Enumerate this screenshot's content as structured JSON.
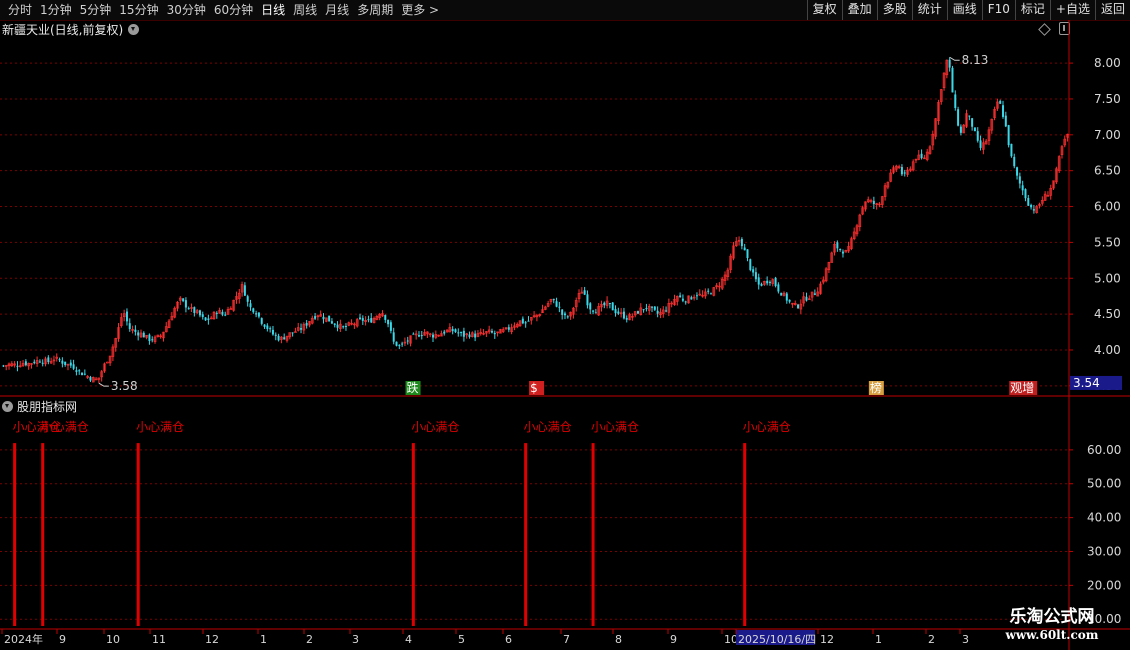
{
  "toolbar": {
    "periods": [
      "分时",
      "1分钟",
      "5分钟",
      "15分钟",
      "30分钟",
      "60分钟",
      "日线",
      "周线",
      "月线",
      "多周期",
      "更多 >"
    ],
    "active_period": "日线",
    "buttons": [
      "复权",
      "叠加",
      "多股",
      "统计",
      "画线",
      "F10",
      "标记",
      "+自选",
      "返回"
    ]
  },
  "chart_title": "新疆天业(日线,前复权)",
  "indicator_title": "股朋指标网",
  "price_axis": {
    "ticks": [
      "8.00",
      "7.50",
      "7.00",
      "6.50",
      "6.00",
      "5.50",
      "5.00",
      "4.50",
      "4.00",
      "3.50"
    ],
    "current_price": "3.54"
  },
  "indicator_axis": {
    "ticks": [
      "60.00",
      "50.00",
      "40.00",
      "30.00",
      "20.00",
      "10.00"
    ]
  },
  "annotations": {
    "high": "8.13",
    "low": "3.58"
  },
  "event_markers": [
    {
      "text": "跌",
      "color": "#1e8a1e"
    },
    {
      "text": "$",
      "color": "#d02020"
    },
    {
      "text": "榜",
      "color": "#d8a040"
    },
    {
      "text": "观增",
      "color": "#c02020"
    }
  ],
  "signals": [
    {
      "text": "小心满仓"
    },
    {
      "text": "小心满仓"
    },
    {
      "text": "小心满仓"
    },
    {
      "text": "小心满仓"
    },
    {
      "text": "小心满仓"
    },
    {
      "text": "小心满仓"
    },
    {
      "text": "小心满仓"
    }
  ],
  "time_axis": [
    "2024年",
    "9",
    "10",
    "11",
    "12",
    "1",
    "2",
    "3",
    "4",
    "5",
    "6",
    "7",
    "8",
    "9",
    "10",
    "2025/10/16/四",
    "12",
    "1",
    "2",
    "3"
  ],
  "watermark": {
    "title": "乐淘公式网",
    "url": "www.60lt.com"
  },
  "colors": {
    "up": "#ff3030",
    "down": "#3ad8e8",
    "grid": "#7a0000",
    "axis": "#c00000",
    "signal": "#e00000"
  },
  "chart_data": {
    "type": "candlestick",
    "y_range": [
      3.4,
      8.35
    ],
    "indicator_range": [
      8,
      70
    ],
    "signal_value": 62,
    "close_path": [
      3.78,
      3.8,
      3.79,
      3.82,
      3.81,
      3.84,
      3.86,
      3.83,
      3.88,
      3.85,
      3.8,
      3.78,
      3.7,
      3.65,
      3.6,
      3.58,
      3.78,
      3.95,
      4.2,
      4.55,
      4.3,
      4.25,
      4.22,
      4.15,
      4.15,
      4.2,
      4.35,
      4.55,
      4.7,
      4.62,
      4.55,
      4.5,
      4.4,
      4.45,
      4.55,
      4.48,
      4.6,
      4.75,
      4.9,
      4.6,
      4.55,
      4.4,
      4.3,
      4.2,
      4.15,
      4.2,
      4.25,
      4.28,
      4.35,
      4.45,
      4.5,
      4.45,
      4.4,
      4.35,
      4.3,
      4.35,
      4.38,
      4.42,
      4.4,
      4.45,
      4.55,
      4.4,
      4.1,
      4.05,
      4.12,
      4.18,
      4.22,
      4.25,
      4.2,
      4.22,
      4.25,
      4.28,
      4.25,
      4.2,
      4.22,
      4.2,
      4.22,
      4.25,
      4.22,
      4.25,
      4.28,
      4.35,
      4.4,
      4.38,
      4.45,
      4.5,
      4.6,
      4.7,
      4.62,
      4.45,
      4.48,
      4.7,
      4.85,
      4.6,
      4.55,
      4.6,
      4.65,
      4.55,
      4.5,
      4.45,
      4.48,
      4.55,
      4.6,
      4.55,
      4.5,
      4.55,
      4.65,
      4.75,
      4.7,
      4.72,
      4.78,
      4.75,
      4.8,
      4.85,
      4.95,
      5.1,
      5.45,
      5.55,
      5.3,
      5.05,
      4.9,
      4.95,
      5.0,
      4.85,
      4.75,
      4.65,
      4.6,
      4.7,
      4.75,
      4.8,
      4.95,
      5.2,
      5.45,
      5.4,
      5.35,
      5.6,
      5.9,
      6.1,
      6.05,
      6.0,
      6.3,
      6.45,
      6.6,
      6.4,
      6.55,
      6.7,
      6.65,
      6.8,
      7.2,
      7.7,
      8.1,
      7.4,
      7.0,
      7.3,
      7.1,
      6.8,
      6.9,
      7.2,
      7.5,
      7.2,
      6.7,
      6.4,
      6.2,
      6.0,
      5.95,
      6.1,
      6.2,
      6.4,
      6.8,
      7.0
    ],
    "signal_bars": [
      4,
      14,
      48,
      146,
      186,
      210,
      264
    ],
    "event_marker_bars": [
      145,
      189,
      310,
      360
    ],
    "bar_count": 380
  }
}
